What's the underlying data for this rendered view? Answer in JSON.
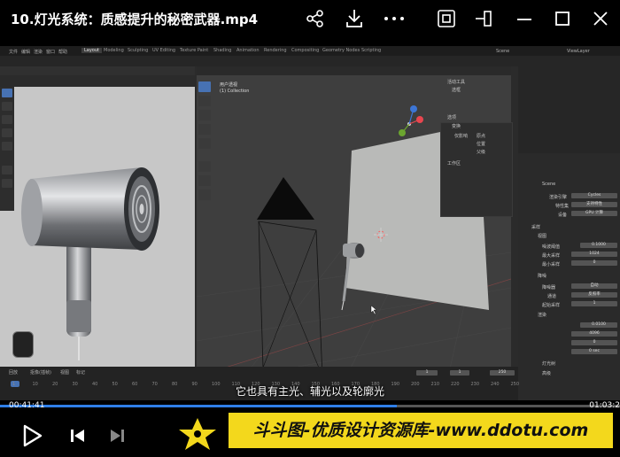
{
  "video": {
    "title": "10.灯光系统：质感提升的秘密武器.mp4",
    "current_time": "00:41:41",
    "total_time": "01:03:2",
    "progress_fraction": 0.64,
    "subtitle": "它也具有主光、辅光以及轮廓光"
  },
  "banner": {
    "text": "斗斗图-优质设计资源库-www.ddotu.com"
  },
  "blender": {
    "tabs": [
      "Layout",
      "Modeling",
      "Sculpting",
      "UV Editing",
      "Texture Paint",
      "Shading",
      "Animation",
      "Rendering",
      "Compositing",
      "Geometry Nodes",
      "Scripting"
    ],
    "active_tab": "Layout",
    "menu": [
      "文件",
      "编辑",
      "渲染",
      "窗口",
      "帮助"
    ],
    "scene_label": "Scene",
    "view_layer_label": "ViewLayer",
    "viewport_label_1": "用户透视",
    "viewport_label_2": "(1) Collection",
    "n_panel": {
      "title": "活动工具",
      "item1": "选框",
      "section": "选项",
      "sub": "变换",
      "affect": "仅影响",
      "opt1": "原点",
      "opt2": "位置",
      "opt3": "父级",
      "workspace": "工作区"
    },
    "props": {
      "scene": "Scene",
      "engine_label": "渲染引擎",
      "engine_value": "Cycles",
      "feature_label": "特性集",
      "feature_value": "支持特性",
      "device_label": "设备",
      "device_value": "GPU 计算",
      "sampling": "采样",
      "viewport": "视图",
      "noise_label": "噪波阈值",
      "noise_value": "0.1000",
      "max_label": "最大采样",
      "max_value": "1024",
      "min_label": "最小采样",
      "min_value": "0",
      "denoise": "降噪",
      "denoiser_label": "降噪器",
      "denoiser_value": "自动",
      "pass_label": "通道",
      "pass_value": "反照率",
      "start_label": "起始采样",
      "start_value": "1",
      "render": "渲染",
      "rnoise_value": "0.0100",
      "rmax_value": "4096",
      "rmin_value": "0",
      "time_value": "0 sec",
      "light_tree": "灯光树",
      "advanced": "高级"
    },
    "timeline": {
      "menu": [
        "回放",
        "抠像(插帧)",
        "视图",
        "标记"
      ],
      "frame": "1",
      "start": "1",
      "end": "250",
      "ticks": [
        "1",
        "10",
        "20",
        "30",
        "40",
        "50",
        "60",
        "70",
        "80",
        "90",
        "100",
        "110",
        "120",
        "130",
        "140",
        "150",
        "160",
        "170",
        "180",
        "190",
        "200",
        "210",
        "220",
        "230",
        "240",
        "250"
      ]
    }
  }
}
